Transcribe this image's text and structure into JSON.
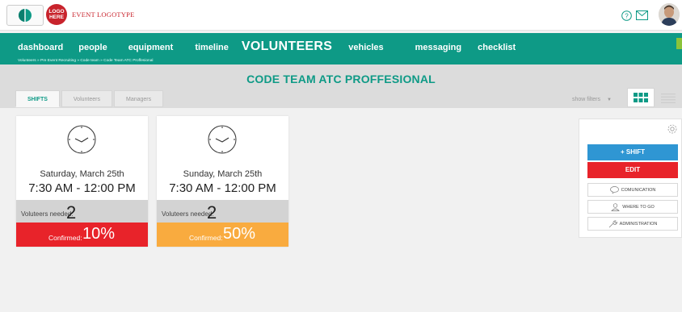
{
  "brand": {
    "circle_text_1": "LOGO",
    "circle_text_2": "HERE",
    "name": "EVENT LOGOTYPE",
    "accent": "#0e9a86",
    "logo_red": "#c8232c"
  },
  "nav": {
    "items": [
      {
        "label": "dashboard"
      },
      {
        "label": "people"
      },
      {
        "label": "equipment"
      },
      {
        "label": "timeline"
      },
      {
        "label": "VOLUNTEERS"
      },
      {
        "label": "vehicles"
      },
      {
        "label": "messaging"
      },
      {
        "label": "checklist"
      }
    ],
    "breadcrumb": "Volunteers » Pre Event Recruiting » Code team » Code Team ATC Proffesional"
  },
  "page": {
    "title": "CODE TEAM ATC PROFFESIONAL",
    "tabs": [
      {
        "label": "SHIFTS",
        "active": true
      },
      {
        "label": "Volunteers"
      },
      {
        "label": "Managers"
      }
    ],
    "filters_label": "show filters"
  },
  "shifts": [
    {
      "date": "Saturday, March 25th",
      "time": "7:30 AM - 12:00 PM",
      "needed_label": "Voluteers needed:",
      "needed_value": "2",
      "confirmed_label": "Confirmed:",
      "confirmed_value": "10%",
      "confirmed_color": "#e8232a"
    },
    {
      "date": "Sunday, March 25th",
      "time": "7:30 AM - 12:00 PM",
      "needed_label": "Voluteers needed:",
      "needed_value": "2",
      "confirmed_label": "Confirmed:",
      "confirmed_value": "50%",
      "confirmed_color": "#f9ab3f"
    }
  ],
  "panel": {
    "add_shift": "+ SHIFT",
    "edit": "EDIT",
    "communication": "COMUNICATION",
    "where_to_go": "WHERE TO GO",
    "administration": "ADMINISTRATION"
  }
}
